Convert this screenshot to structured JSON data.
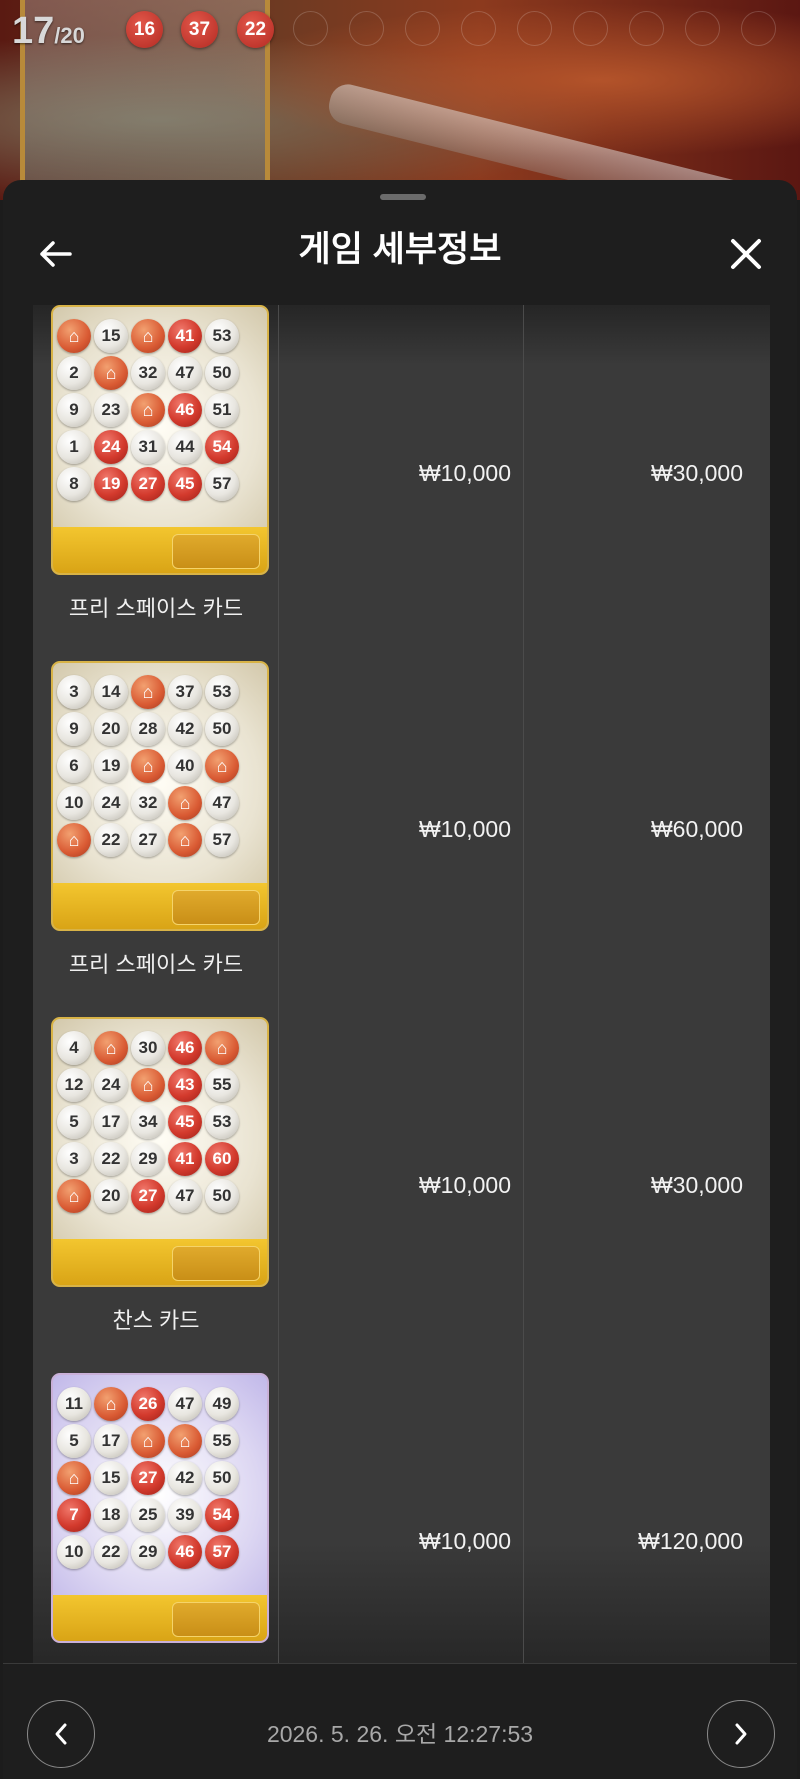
{
  "game": {
    "count_drawn": "17",
    "count_total": "/20",
    "drawn_balls": [
      "16",
      "37",
      "22"
    ]
  },
  "header": {
    "title": "게임 세부정보"
  },
  "rows": [
    {
      "card_name": "프리 스페이스 카드",
      "bet": "₩10,000",
      "win": "₩30,000",
      "card_theme": "gold",
      "grid": [
        [
          "F",
          "15",
          "F",
          "41",
          "53"
        ],
        [
          "2",
          "F",
          "32",
          "47",
          "50"
        ],
        [
          "9",
          "23",
          "F",
          "46",
          "51"
        ],
        [
          "1",
          "24",
          "31",
          "44",
          "54"
        ],
        [
          "8",
          "19",
          "27",
          "45",
          "57"
        ]
      ],
      "red": [
        "41",
        "46",
        "24",
        "19",
        "27",
        "45",
        "54"
      ]
    },
    {
      "card_name": "프리 스페이스 카드",
      "bet": "₩10,000",
      "win": "₩60,000",
      "card_theme": "gold",
      "grid": [
        [
          "3",
          "14",
          "F",
          "37",
          "53"
        ],
        [
          "9",
          "20",
          "28",
          "42",
          "50"
        ],
        [
          "6",
          "19",
          "F",
          "40",
          "F"
        ],
        [
          "10",
          "24",
          "32",
          "F",
          "47"
        ],
        [
          "F",
          "22",
          "27",
          "F",
          "57"
        ]
      ],
      "red": []
    },
    {
      "card_name": "찬스 카드",
      "bet": "₩10,000",
      "win": "₩30,000",
      "card_theme": "gold",
      "grid": [
        [
          "4",
          "F",
          "30",
          "46",
          "F"
        ],
        [
          "12",
          "24",
          "F",
          "43",
          "55"
        ],
        [
          "5",
          "17",
          "34",
          "45",
          "53"
        ],
        [
          "3",
          "22",
          "29",
          "41",
          "60"
        ],
        [
          "F",
          "20",
          "27",
          "47",
          "50"
        ]
      ],
      "red": [
        "46",
        "43",
        "45",
        "41",
        "60",
        "27"
      ]
    },
    {
      "card_name": "",
      "bet": "₩10,000",
      "win": "₩120,000",
      "card_theme": "purple",
      "grid": [
        [
          "11",
          "F",
          "26",
          "47",
          "49"
        ],
        [
          "5",
          "17",
          "F",
          "F",
          "55"
        ],
        [
          "F",
          "15",
          "27",
          "42",
          "50"
        ],
        [
          "7",
          "18",
          "25",
          "39",
          "54"
        ],
        [
          "10",
          "22",
          "29",
          "46",
          "57"
        ]
      ],
      "red": [
        "26",
        "27",
        "7",
        "54",
        "46",
        "57"
      ]
    }
  ],
  "footer": {
    "datetime": "2026. 5. 26. 오전 12:27:53"
  },
  "icons": {
    "back": "arrow-left-icon",
    "close": "close-icon",
    "prev": "chevron-left-icon",
    "next": "chevron-right-icon"
  }
}
